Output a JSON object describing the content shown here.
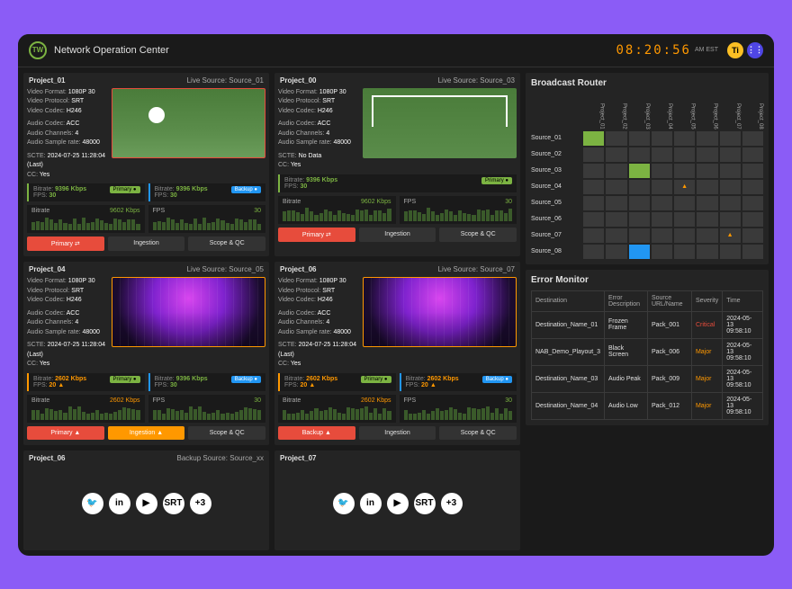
{
  "header": {
    "logo": "TW",
    "title": "Network Operation Center",
    "clock": "08:20:56",
    "clock_suffix": "AM EST",
    "icons": {
      "ti": "Ti",
      "dots": "⋮⋮"
    }
  },
  "projects": [
    {
      "name": "Project_01",
      "live": "Live Source: Source_01",
      "meta": {
        "vformat": "1080P 30",
        "vprotocol": "SRT",
        "vcodec": "H246",
        "acodec": "ACC",
        "achannels": "4",
        "asample": "48000",
        "scte": "2024-07-25 11:28:04 (Last)",
        "cc": "Yes"
      },
      "status": [
        {
          "cls": "green",
          "bitrate": "9396 Kbps",
          "fps": "30",
          "badge": "Primary ●"
        },
        {
          "cls": "blue",
          "bitrate": "9396 Kbps",
          "fps": "30",
          "badge": "Backup ●"
        }
      ],
      "bitrate": {
        "label": "Bitrate",
        "value": "9602 Kbps",
        "fps_label": "FPS",
        "fps": "30"
      },
      "btns": [
        "Primary ⇄",
        "Ingestion",
        "Scope & QC"
      ],
      "btn_classes": [
        "primary-btn",
        "",
        ""
      ]
    },
    {
      "name": "Project_00",
      "live": "Live Source: Source_03",
      "meta": {
        "vformat": "1080P 30",
        "vprotocol": "SRT",
        "vcodec": "H246",
        "acodec": "ACC",
        "achannels": "4",
        "asample": "48000",
        "scte": "No Data",
        "cc": "Yes"
      },
      "status": [
        {
          "cls": "green",
          "bitrate": "9396 Kbps",
          "fps": "30",
          "badge": "Primary ●"
        }
      ],
      "bitrate": {
        "label": "Bitrate",
        "value": "9602 Kbps",
        "fps_label": "FPS",
        "fps": "30"
      },
      "btns": [
        "Primary ⇄",
        "Ingestion",
        "Scope & QC"
      ],
      "btn_classes": [
        "primary-btn",
        "",
        ""
      ]
    },
    {
      "name": "Project_04",
      "live": "Live Source: Source_05",
      "meta": {
        "vformat": "1080P 30",
        "vprotocol": "SRT",
        "vcodec": "H246",
        "acodec": "ACC",
        "achannels": "4",
        "asample": "48000",
        "scte": "2024-07-25 11:28:04 (Last)",
        "cc": "Yes"
      },
      "status": [
        {
          "cls": "orange",
          "bitrate": "2602 Kbps",
          "fps": "20",
          "badge": "Primary ●",
          "warn": true
        },
        {
          "cls": "blue",
          "bitrate": "9396 Kbps",
          "fps": "30",
          "badge": "Backup ●"
        }
      ],
      "bitrate": {
        "label": "Bitrate",
        "value": "2602 Kbps",
        "fps_label": "FPS",
        "fps": "30",
        "orange": true
      },
      "btns": [
        "Primary ▲",
        "Ingestion ▲",
        "Scope & QC"
      ],
      "btn_classes": [
        "primary-btn",
        "warn-btn",
        ""
      ]
    },
    {
      "name": "Project_06",
      "live": "Live Source: Source_07",
      "meta": {
        "vformat": "1080P 30",
        "vprotocol": "SRT",
        "vcodec": "H246",
        "acodec": "ACC",
        "achannels": "4",
        "asample": "48000",
        "scte": "2024-07-25 11:28:04 (Last)",
        "cc": "Yes"
      },
      "status": [
        {
          "cls": "orange",
          "bitrate": "2602 Kbps",
          "fps": "20",
          "badge": "Primary ●",
          "warn": true
        },
        {
          "cls": "blue",
          "bitrate": "2602 Kbps",
          "fps": "20",
          "badge": "Backup ●",
          "warn": true
        }
      ],
      "bitrate": {
        "label": "Bitrate",
        "value": "2602 Kbps",
        "fps_label": "FPS",
        "fps": "30",
        "orange": true
      },
      "btns": [
        "Backup ▲",
        "Ingestion",
        "Scope & QC"
      ],
      "btn_classes": [
        "primary-btn",
        "",
        ""
      ]
    }
  ],
  "bottom_projects": [
    {
      "name": "Project_06",
      "live": "Backup Source: Source_xx"
    },
    {
      "name": "Project_07",
      "live": ""
    }
  ],
  "social": [
    "🐦",
    "in",
    "▶",
    "SRT",
    "+3"
  ],
  "meta_labels": {
    "vformat": "Video Format:",
    "vprotocol": "Video Protocol:",
    "vcodec": "Video Codec:",
    "acodec": "Audio Codec:",
    "achannels": "Audio Channels:",
    "asample": "Audio Sample rate:",
    "scte": "SCTE:",
    "cc": "CC:",
    "bitrate": "Bitrate:",
    "fps": "FPS:"
  },
  "router": {
    "title": "Broadcast Router",
    "cols": [
      "Project_01",
      "Project_02",
      "Project_03",
      "Project_04",
      "Project_05",
      "Project_06",
      "Project_07",
      "Project_08"
    ],
    "rows": [
      {
        "label": "Source_01",
        "cells": [
          "green",
          "",
          "",
          "",
          "",
          "",
          "",
          ""
        ]
      },
      {
        "label": "Source_02",
        "cells": [
          "",
          "",
          "",
          "",
          "",
          "",
          "",
          ""
        ]
      },
      {
        "label": "Source_03",
        "cells": [
          "",
          "",
          "green",
          "",
          "",
          "",
          "",
          ""
        ]
      },
      {
        "label": "Source_04",
        "cells": [
          "",
          "",
          "",
          "",
          "warn",
          "",
          "",
          ""
        ]
      },
      {
        "label": "Source_05",
        "cells": [
          "",
          "",
          "",
          "",
          "",
          "",
          "",
          ""
        ]
      },
      {
        "label": "Source_06",
        "cells": [
          "",
          "",
          "",
          "",
          "",
          "",
          "",
          ""
        ]
      },
      {
        "label": "Source_07",
        "cells": [
          "",
          "",
          "",
          "",
          "",
          "",
          "warn",
          ""
        ]
      },
      {
        "label": "Source_08",
        "cells": [
          "",
          "",
          "blue",
          "",
          "",
          "",
          "",
          ""
        ]
      }
    ]
  },
  "errors": {
    "title": "Error Monitor",
    "headers": [
      "Destination",
      "Error Description",
      "Source URL/Name",
      "Severity",
      "Time"
    ],
    "rows": [
      {
        "dest": "Destination_Name_01",
        "err": "Frozen Frame",
        "src": "Pack_001",
        "sev": "Critical",
        "sev_cls": "sev-crit",
        "time": "2024-05-13 09:58:10"
      },
      {
        "dest": "NAB_Demo_Playout_3",
        "err": "Black Screen",
        "src": "Pack_006",
        "sev": "Major",
        "sev_cls": "sev-major",
        "time": "2024-05-13 09:58:10"
      },
      {
        "dest": "Destination_Name_03",
        "err": "Audio Peak",
        "src": "Pack_009",
        "sev": "Major",
        "sev_cls": "sev-major",
        "time": "2024-05-13 09:58:10"
      },
      {
        "dest": "Destination_Name_04",
        "err": "Audio Low",
        "src": "Pack_012",
        "sev": "Major",
        "sev_cls": "sev-major",
        "time": "2024-05-13 09:58:10"
      }
    ]
  }
}
